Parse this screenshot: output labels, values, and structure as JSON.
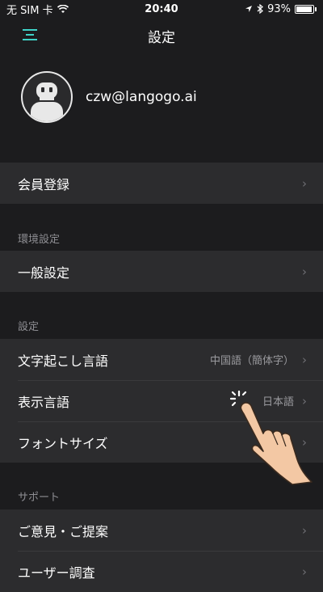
{
  "status_bar": {
    "carrier": "无 SIM 卡",
    "time": "20:40",
    "battery": "93%",
    "battery_level": 0.93
  },
  "nav": {
    "title": "設定"
  },
  "profile": {
    "email": "czw@langogo.ai"
  },
  "sections": {
    "membership": {
      "label": "会員登録"
    },
    "environment": {
      "header": "環境設定",
      "general": "一般設定"
    },
    "settings": {
      "header": "設定",
      "transcription_label": "文字起こし言語",
      "transcription_value": "中国語（簡体字）",
      "display_label": "表示言語",
      "display_value": "日本語",
      "font_label": "フォントサイズ"
    },
    "support": {
      "header": "サポート",
      "feedback": "ご意見・ご提案",
      "survey": "ユーザー調査"
    }
  },
  "colors": {
    "accent": "#3fd2c7",
    "background": "#1c1c1e",
    "row": "#2c2c2e"
  },
  "icons": {
    "chevron": "›",
    "menu": "menu-icon",
    "wifi": "wifi-icon",
    "location": "location-icon",
    "bluetooth": "bluetooth-icon"
  }
}
